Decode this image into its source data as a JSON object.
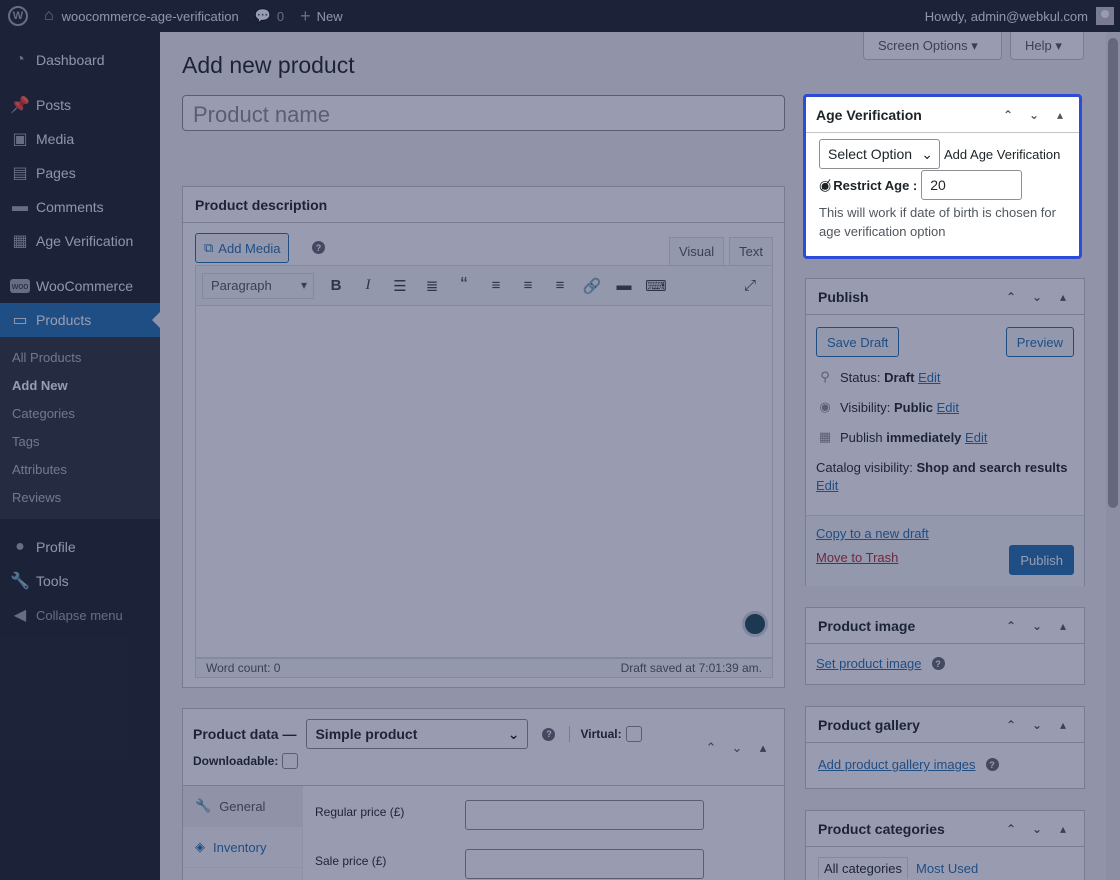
{
  "adminbar": {
    "site_name": "woocommerce-age-verification",
    "comments_count": "0",
    "new_label": "New",
    "howdy": "Howdy, admin@webkul.com"
  },
  "sidebar": {
    "items": [
      {
        "label": "Dashboard",
        "icon": "dashboard-icon"
      },
      {
        "label": "Posts",
        "icon": "pin-icon"
      },
      {
        "label": "Media",
        "icon": "media-icon"
      },
      {
        "label": "Pages",
        "icon": "pages-icon"
      },
      {
        "label": "Comments",
        "icon": "comment-icon"
      },
      {
        "label": "Age Verification",
        "icon": "calendar-icon"
      },
      {
        "label": "WooCommerce",
        "icon": "woo-icon"
      },
      {
        "label": "Products",
        "icon": "archive-icon"
      },
      {
        "label": "Profile",
        "icon": "user-icon"
      },
      {
        "label": "Tools",
        "icon": "wrench-icon"
      },
      {
        "label": "Collapse menu",
        "icon": "collapse-icon"
      }
    ],
    "submenu": [
      "All Products",
      "Add New",
      "Categories",
      "Tags",
      "Attributes",
      "Reviews"
    ]
  },
  "screen_options": "Screen Options",
  "help": "Help",
  "page_title": "Add new product",
  "product_name_placeholder": "Product name",
  "description": {
    "title": "Product description",
    "add_media": "Add Media",
    "tab_visual": "Visual",
    "tab_text": "Text",
    "format": "Paragraph",
    "word_count": "Word count: 0",
    "draft_saved": "Draft saved at 7:01:39 am."
  },
  "product_data": {
    "title": "Product data —",
    "type": "Simple product",
    "virtual": "Virtual:",
    "downloadable": "Downloadable:",
    "tabs": [
      "General",
      "Inventory"
    ],
    "regular_price": "Regular price (£)",
    "sale_price": "Sale price (£)"
  },
  "age_verification": {
    "title": "Age Verification",
    "select": "Select Option",
    "add_label": "Add Age Verification",
    "restrict_label": "Restrict Age :",
    "restrict_value": "20",
    "note": "This will work if date of birth is chosen for age verification option"
  },
  "publish": {
    "title": "Publish",
    "save_draft": "Save Draft",
    "preview": "Preview",
    "status_label": "Status:",
    "status_value": "Draft",
    "visibility_label": "Visibility:",
    "visibility_value": "Public",
    "publish_label": "Publish",
    "publish_value": "immediately",
    "catalog_label": "Catalog visibility:",
    "catalog_value": "Shop and search results",
    "edit": "Edit",
    "copy_draft": "Copy to a new draft",
    "trash": "Move to Trash",
    "publish_btn": "Publish"
  },
  "product_image": {
    "title": "Product image",
    "link": "Set product image"
  },
  "product_gallery": {
    "title": "Product gallery",
    "link": "Add product gallery images"
  },
  "product_categories": {
    "title": "Product categories",
    "tab_all": "All categories",
    "tab_used": "Most Used"
  }
}
